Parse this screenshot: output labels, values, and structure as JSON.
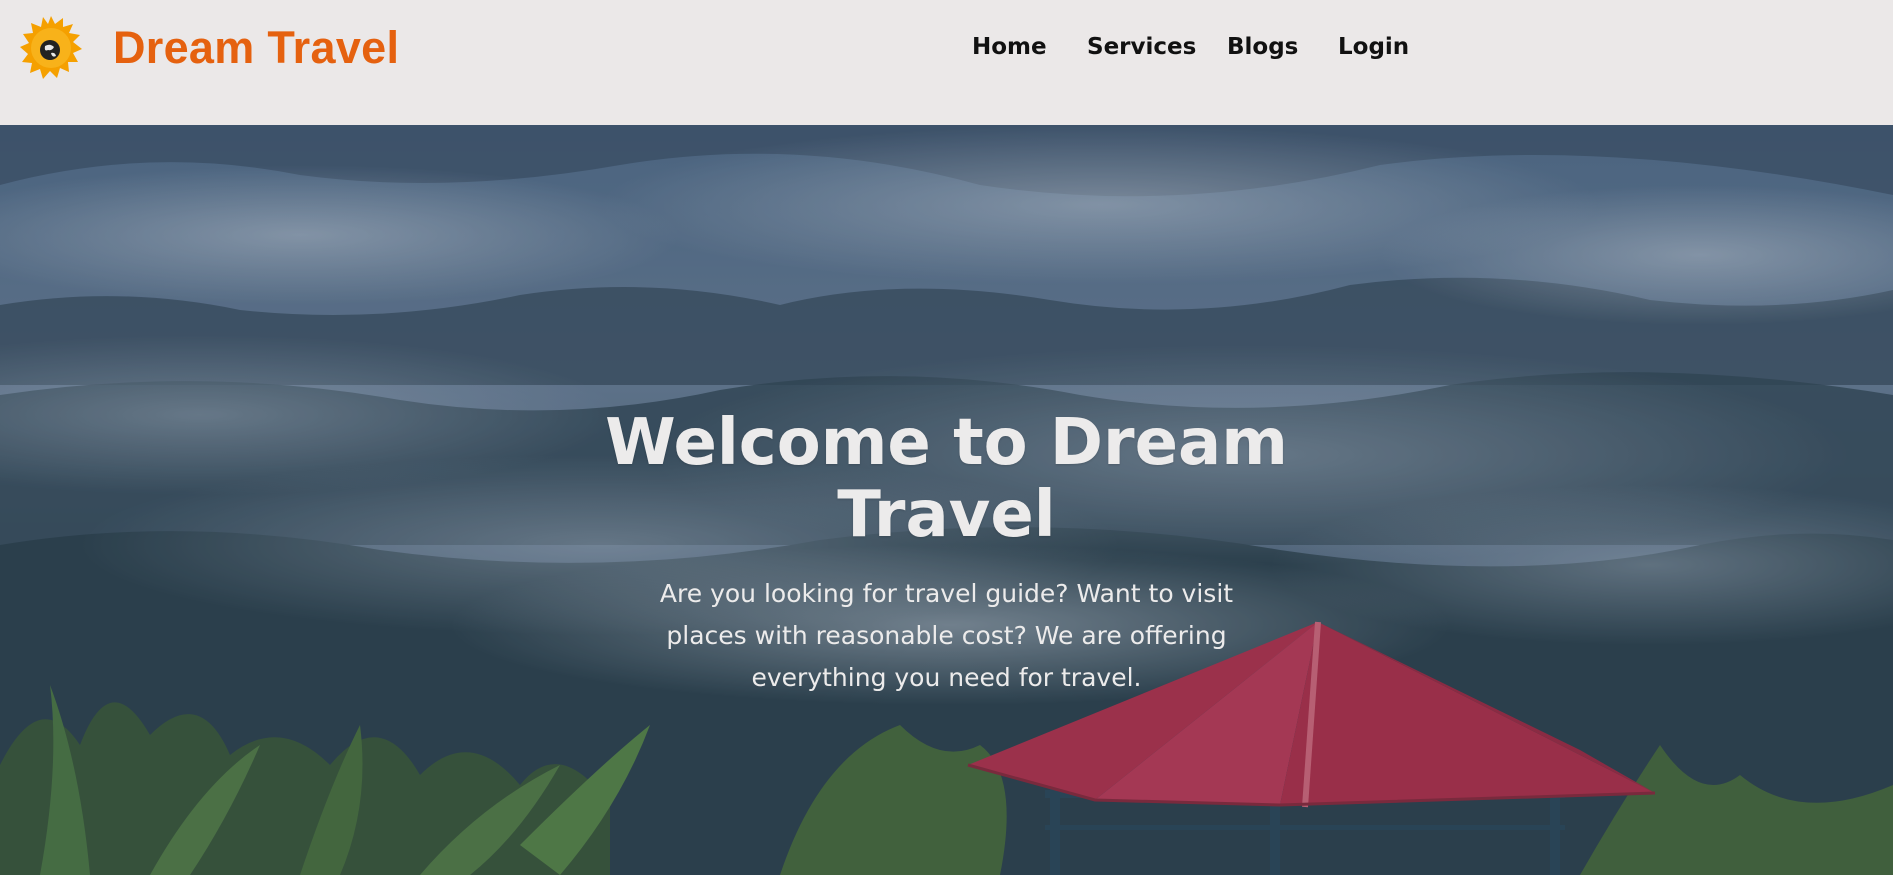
{
  "header": {
    "brand": "Dream Travel",
    "logo_icon": "globe-splash-logo-icon",
    "nav": [
      {
        "label": "Home"
      },
      {
        "label": "Services"
      },
      {
        "label": "Blogs"
      },
      {
        "label": "Login"
      }
    ]
  },
  "hero": {
    "title": "Welcome to Dream Travel",
    "subtitle": "Are you looking for travel guide? Want to visit places with reasonable cost? We are offering everything you need for travel.",
    "background": "misty-forest-hills-with-red-roof-gazebo"
  },
  "colors": {
    "brand": "#e5610f",
    "logo": "#f5a000",
    "nav_bg": "#ebe8e8",
    "nav_text": "#111111",
    "hero_text": "#ecebeb",
    "hero_overlay": "#4d6278",
    "roof": "#c23b5a"
  }
}
